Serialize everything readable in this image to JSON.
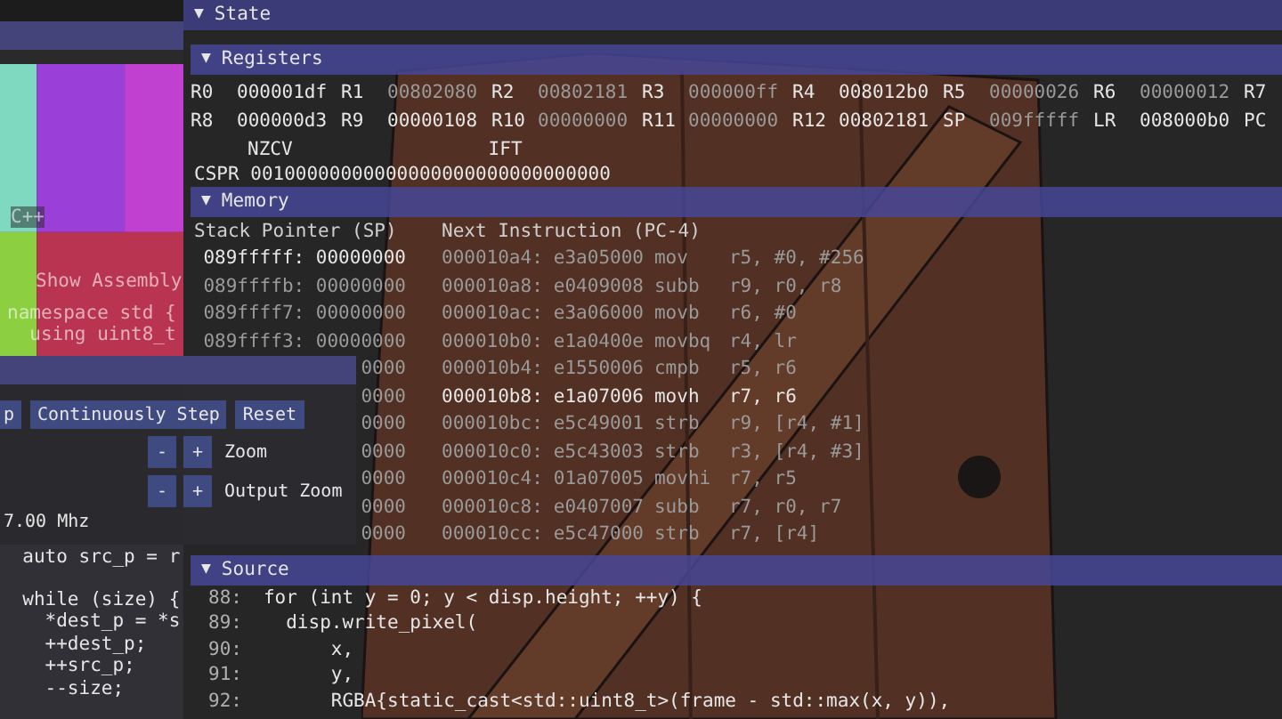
{
  "display_window": {
    "section": "C++",
    "checkbox_label": "Show Assembly",
    "code_lines": [
      "namespace std {",
      "  using uint8_t"
    ]
  },
  "control_window": {
    "buttons": [
      "p",
      "Continuously Step",
      "Reset"
    ],
    "zoom_controls": [
      {
        "minus": "-",
        "plus": "+",
        "label": "Zoom"
      },
      {
        "minus": "-",
        "plus": "+",
        "label": "Output Zoom"
      }
    ],
    "clock": "7.00 Mhz"
  },
  "editor_panel": {
    "code_blocks": [
      [
        "  auto src_p = r"
      ],
      [
        "  while (size) {",
        "    *dest_p = *s",
        "    ++dest_p;",
        "    ++src_p;",
        "    --size;"
      ]
    ]
  },
  "state_window": {
    "title": "State",
    "toggle": "▼",
    "registers": {
      "title": "Registers",
      "toggle": "▼",
      "rows": [
        [
          {
            "name": "R0",
            "value": "000001df",
            "changed": true
          },
          {
            "name": "R1",
            "value": "00802080",
            "changed": false
          },
          {
            "name": "R2",
            "value": "00802181",
            "changed": false
          },
          {
            "name": "R3",
            "value": "000000ff",
            "changed": false
          },
          {
            "name": "R4",
            "value": "008012b0",
            "changed": true
          },
          {
            "name": "R5",
            "value": "00000026",
            "changed": false
          },
          {
            "name": "R6",
            "value": "00000012",
            "changed": false
          },
          {
            "name": "R7"
          }
        ],
        [
          {
            "name": "R8",
            "value": "000000d3",
            "changed": true
          },
          {
            "name": "R9",
            "value": "00000108",
            "changed": true
          },
          {
            "name": "R10",
            "value": "00000000",
            "changed": false
          },
          {
            "name": "R11",
            "value": "00000000",
            "changed": false
          },
          {
            "name": "R12",
            "value": "00802181",
            "changed": true
          },
          {
            "name": "SP",
            "value": "009fffff",
            "changed": false
          },
          {
            "name": "LR",
            "value": "008000b0",
            "changed": true
          },
          {
            "name": "PC"
          }
        ]
      ],
      "flags": [
        "NZCV",
        "IFT"
      ],
      "cpsr_label": "CSPR",
      "cpsr_value": "00100000000000000000000000000000"
    },
    "memory": {
      "title": "Memory",
      "toggle": "▼",
      "stack_heading": "Stack Pointer (SP)",
      "instruction_heading": "Next Instruction (PC-4)",
      "stack": [
        {
          "text": "089fffff: 00000000",
          "highlighted": true
        },
        {
          "text": "089ffffb: 00000000",
          "highlighted": false
        },
        {
          "text": "089ffff7: 00000000",
          "highlighted": false
        },
        {
          "text": "089ffff3: 00000000",
          "highlighted": false
        },
        {
          "text": "0000",
          "highlighted": false
        },
        {
          "text": "0000",
          "highlighted": false
        },
        {
          "text": "0000",
          "highlighted": false
        },
        {
          "text": "0000",
          "highlighted": false
        },
        {
          "text": "0000",
          "highlighted": false
        },
        {
          "text": "0000",
          "highlighted": false
        },
        {
          "text": "0000",
          "highlighted": false
        }
      ],
      "instructions": [
        {
          "address": "000010a4:",
          "code": "e3a05000",
          "op": "mov",
          "args": "r5, #0, #256",
          "highlighted": false
        },
        {
          "address": "000010a8:",
          "code": "e0409008",
          "op": "subb",
          "args": "r9, r0, r8",
          "highlighted": false
        },
        {
          "address": "000010ac:",
          "code": "e3a06000",
          "op": "movb",
          "args": "r6, #0",
          "highlighted": false
        },
        {
          "address": "000010b0:",
          "code": "e1a0400e",
          "op": "movbq",
          "args": "r4, lr",
          "highlighted": false
        },
        {
          "address": "000010b4:",
          "code": "e1550006",
          "op": "cmpb",
          "args": "r5, r6",
          "highlighted": false
        },
        {
          "address": "000010b8:",
          "code": "e1a07006",
          "op": "movh",
          "args": "r7, r6",
          "highlighted": true
        },
        {
          "address": "000010bc:",
          "code": "e5c49001",
          "op": "strb",
          "args": "r9, [r4, #1]",
          "highlighted": false
        },
        {
          "address": "000010c0:",
          "code": "e5c43003",
          "op": "strb",
          "args": "r3, [r4, #3]",
          "highlighted": false
        },
        {
          "address": "000010c4:",
          "code": "01a07005",
          "op": "movhi",
          "args": "r7, r5",
          "highlighted": false
        },
        {
          "address": "000010c8:",
          "code": "e0407007",
          "op": "subb",
          "args": "r7, r0, r7",
          "highlighted": false
        },
        {
          "address": "000010cc:",
          "code": "e5c47000",
          "op": "strb",
          "args": "r7, [r4]",
          "highlighted": false
        }
      ]
    },
    "source": {
      "title": "Source",
      "toggle": "▼",
      "lines": [
        {
          "number": "88:",
          "text": "for (int y = 0; y < disp.height; ++y) {"
        },
        {
          "number": "89:",
          "text": "  disp.write_pixel("
        },
        {
          "number": "90:",
          "text": "      x,"
        },
        {
          "number": "91:",
          "text": "      y,"
        },
        {
          "number": "92:",
          "text": "      RGBA{static_cast<std::uint8_t>(frame - std::max(x, y)),"
        }
      ]
    }
  }
}
